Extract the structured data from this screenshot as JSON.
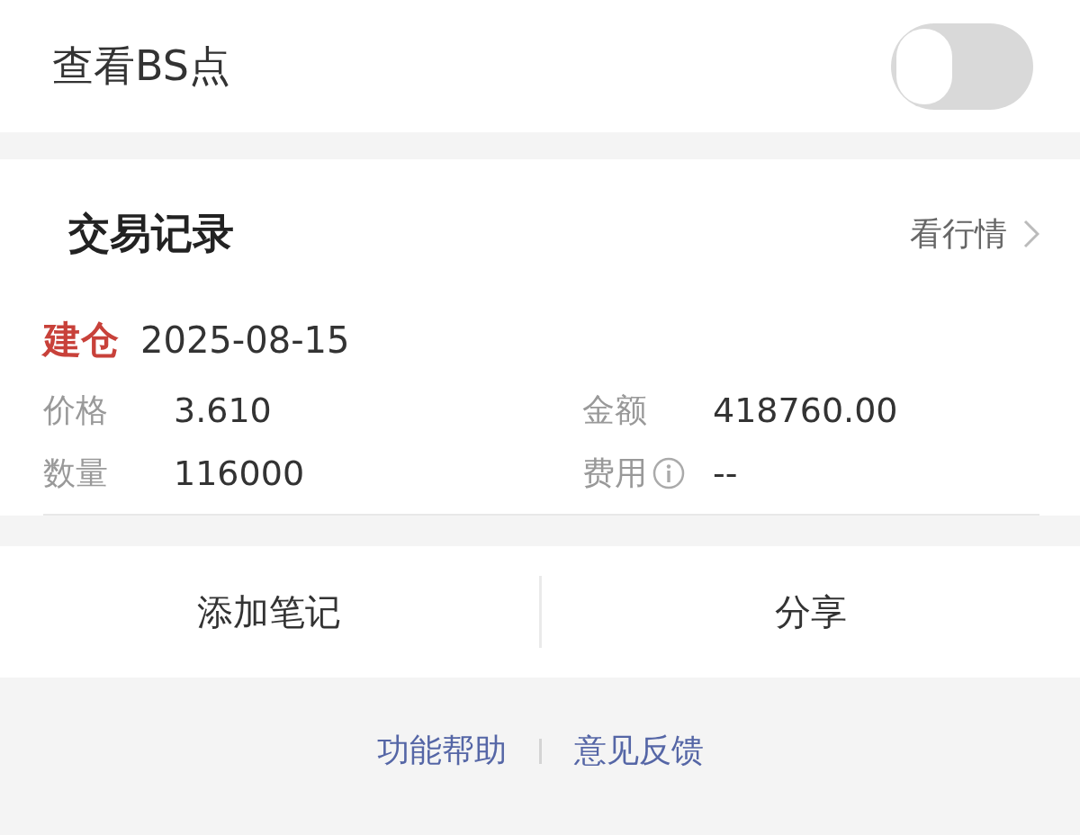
{
  "settings": {
    "label": "查看BS点",
    "on": false
  },
  "trade_record": {
    "title": "交易记录",
    "link": "看行情",
    "entries": [
      {
        "type": "建仓",
        "date": "2025-08-15",
        "fields": [
          {
            "label": "价格",
            "value": "3.610",
            "info": false
          },
          {
            "label": "金额",
            "value": "418760.00",
            "info": false
          },
          {
            "label": "数量",
            "value": "116000",
            "info": false
          },
          {
            "label": "费用",
            "value": "--",
            "info": true
          }
        ]
      }
    ]
  },
  "actions": [
    "添加笔记",
    "分享"
  ],
  "footer_links": [
    "功能帮助",
    "意见反馈"
  ]
}
